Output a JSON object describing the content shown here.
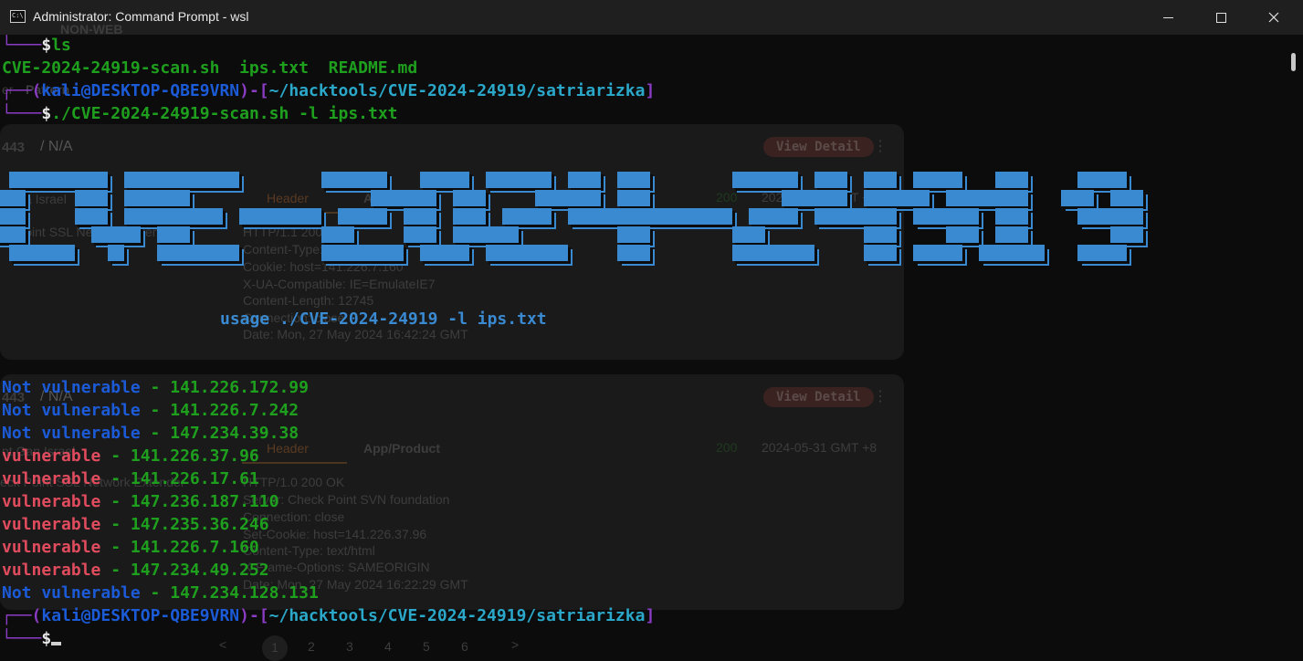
{
  "window": {
    "title": "Administrator: Command Prompt - wsl"
  },
  "ghost": {
    "nonweb": "NON-WEB",
    "nav_left": "er",
    "nav_pattern": "Pattern",
    "card1_count": "443",
    "card1_na": "/  N/A",
    "view_detail": "View Detail",
    "tab_header": "Header",
    "tab_product": "App/Product",
    "status_code": "200",
    "card1_date": "2024-05-31 GMT +8",
    "card1_org": "Saba Israel",
    "card1_product": "ck Point SSL Network Extender",
    "card1_h1": "HTTP/1.1 200 OK",
    "card1_h2": "Content-Type: text/html",
    "card1_h3": "Cookie: host=141.226.7.160",
    "card1_h4": "X-UA-Compatible: IE=EmulateIE7",
    "card1_h5": "Content-Length: 12745",
    "card1_h6": "Connection: close",
    "card1_h7": "Date: Mon, 27 May 2024 16:42:24 GMT",
    "card2_count": "443",
    "card2_na": "/  N/A",
    "card2_date": "2024-05-31 GMT +8",
    "card2_org": "nt Gan Israel",
    "card2_product": "eck Point SSL Network Extender",
    "card2_h1": "HTTP/1.0 200 OK",
    "card2_h2": "Server: Check Point SVN foundation",
    "card2_h3": "Connection: close",
    "card2_h4": "Set-Cookie: host=141.226.37.96",
    "card2_h5": "Content-Type: text/html",
    "card2_h6": "X-Frame-Options: SAMEORIGIN",
    "card2_h7": "Date: Mon, 27 May 2024 16:22:29 GMT",
    "pager_prev": "<",
    "pager_pages": [
      "1",
      "2",
      "3",
      "4",
      "5",
      "6"
    ],
    "pager_next": ">"
  },
  "terminal": {
    "prompt_corner_top": "┌──",
    "prompt_corner_bottom": "└─",
    "prompt_user": "kali",
    "prompt_at": "@",
    "prompt_host": "DESKTOP-QBE9VRN",
    "prompt_path": "~/hacktools/CVE-2024-24919/satriarizka",
    "dollar": "$",
    "cmd_ls": "ls",
    "ls_output": "CVE-2024-24919-scan.sh  ips.txt  README.md",
    "cmd_scan": "./CVE-2024-24919-scan.sh -l ips.txt",
    "usage": "usage ./CVE-2024-24919 -l ips.txt",
    "results": [
      {
        "status": "Not vulnerable",
        "ip": "141.226.172.99",
        "vuln": false
      },
      {
        "status": "Not vulnerable",
        "ip": "141.226.7.242",
        "vuln": false
      },
      {
        "status": "Not vulnerable",
        "ip": "147.234.39.38",
        "vuln": false
      },
      {
        "status": "vulnerable",
        "ip": "141.226.37.96",
        "vuln": true
      },
      {
        "status": "vulnerable",
        "ip": "141.226.17.61",
        "vuln": true
      },
      {
        "status": "vulnerable",
        "ip": "147.236.187.110",
        "vuln": true
      },
      {
        "status": "vulnerable",
        "ip": "147.235.36.246",
        "vuln": true
      },
      {
        "status": "vulnerable",
        "ip": "141.226.7.160",
        "vuln": true
      },
      {
        "status": "vulnerable",
        "ip": "147.234.49.252",
        "vuln": true
      },
      {
        "status": "Not vulnerable",
        "ip": "147.234.128.131",
        "vuln": false
      }
    ],
    "separator": " - "
  },
  "banner": {
    "text": "CVE-2024-24919",
    "color": "#3a8ad1"
  },
  "colors": {
    "background": "#0c0c0c",
    "prompt_frame": "#8a3cc4",
    "not_vulnerable": "#1c5bd8",
    "vulnerable": "#e04c5e",
    "ip": "#1ea01e",
    "path": "#2aa7c9"
  }
}
